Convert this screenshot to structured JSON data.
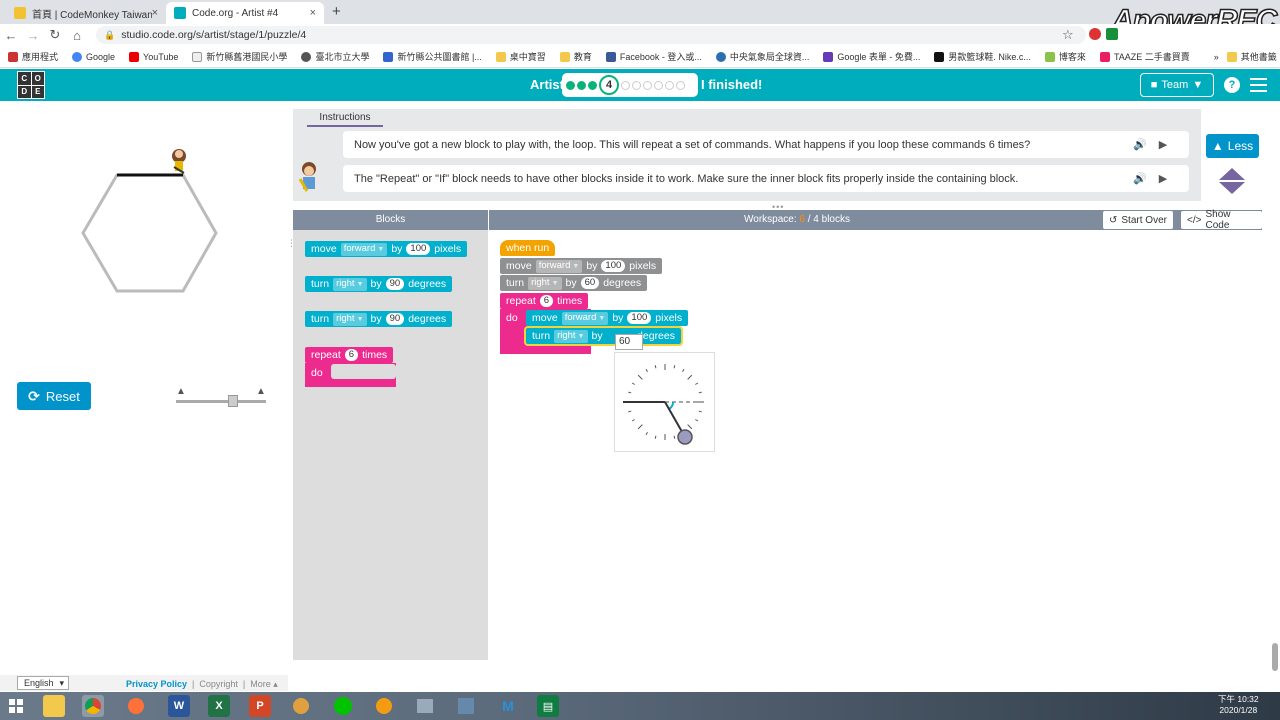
{
  "browser": {
    "tabs": [
      {
        "title": "首頁 | CodeMonkey Taiwan",
        "close": "×"
      },
      {
        "title": "Code.org - Artist #4",
        "close": "×"
      }
    ],
    "new_tab": "+",
    "url": "studio.code.org/s/artist/stage/1/puzzle/4",
    "recorder_watermark": "ApowerREC",
    "bookmarks": [
      "應用程式",
      "Google",
      "YouTube",
      "新竹縣舊港國民小學",
      "臺北市立大學",
      "新竹縣公共圖書館 |...",
      "桌中寶習",
      "教育",
      "Facebook - 登入或...",
      "中央氣象局全球資...",
      "Google 表單 - 免費...",
      "男款籃球鞋. Nike.c...",
      "博客來",
      "TAAZE 二手書買賣",
      "其他書籤"
    ],
    "bookmarks_more": "»"
  },
  "header": {
    "logo_letters": [
      "C",
      "O",
      "D",
      "E"
    ],
    "title": "Artist",
    "current_level": "4",
    "progress": {
      "done": 3,
      "todo": 6
    },
    "finished": "I finished!",
    "team_label": "Team",
    "help": "?"
  },
  "instructions": {
    "tab": "Instructions",
    "line1": "Now you've got a new block to play with, the loop. This will repeat a set of commands. What happens if you loop these commands 6 times?",
    "line2": "The \"Repeat\" or \"If\" block needs to have other blocks inside it to work. Make sure the inner block fits properly inside the containing block.",
    "less": "Less"
  },
  "controls": {
    "reset": "Reset"
  },
  "toolbox": {
    "header": "Blocks",
    "blocks": [
      {
        "parts": [
          "move",
          "forward",
          "by",
          "100",
          "pixels"
        ]
      },
      {
        "parts": [
          "turn",
          "right",
          "by",
          "90",
          "degrees"
        ]
      },
      {
        "parts": [
          "turn",
          "right",
          "by",
          "90",
          "degrees"
        ]
      },
      {
        "parts": [
          "repeat",
          "6",
          "times"
        ],
        "do": "do"
      }
    ]
  },
  "workspace": {
    "label": "Workspace:",
    "count": "6",
    "limit": "/ 4 blocks",
    "start_over": "Start Over",
    "show_code": "Show Code",
    "when_run": "when run",
    "move": [
      "move",
      "forward",
      "by",
      "100",
      "pixels"
    ],
    "turn": [
      "turn",
      "right",
      "by",
      "60",
      "degrees"
    ],
    "repeat": [
      "repeat",
      "6",
      "times"
    ],
    "do": "do",
    "inner_move": [
      "move",
      "forward",
      "by",
      "100",
      "pixels"
    ],
    "inner_turn": [
      "turn",
      "right",
      "by",
      "degrees"
    ],
    "editing_value": "60"
  },
  "footer": {
    "language": "English",
    "privacy": "Privacy Policy",
    "copyright": "Copyright",
    "more": "More ▴"
  },
  "taskbar": {
    "time": "下午 10:32",
    "date": "2020/1/28"
  },
  "colors": {
    "header": "#00adbc",
    "draw_block": "#00b0cd",
    "loop_block": "#ed2b8f",
    "event_block": "#f3a300",
    "reset_button": "#0094ca",
    "progress_green": "#0ab37c"
  }
}
